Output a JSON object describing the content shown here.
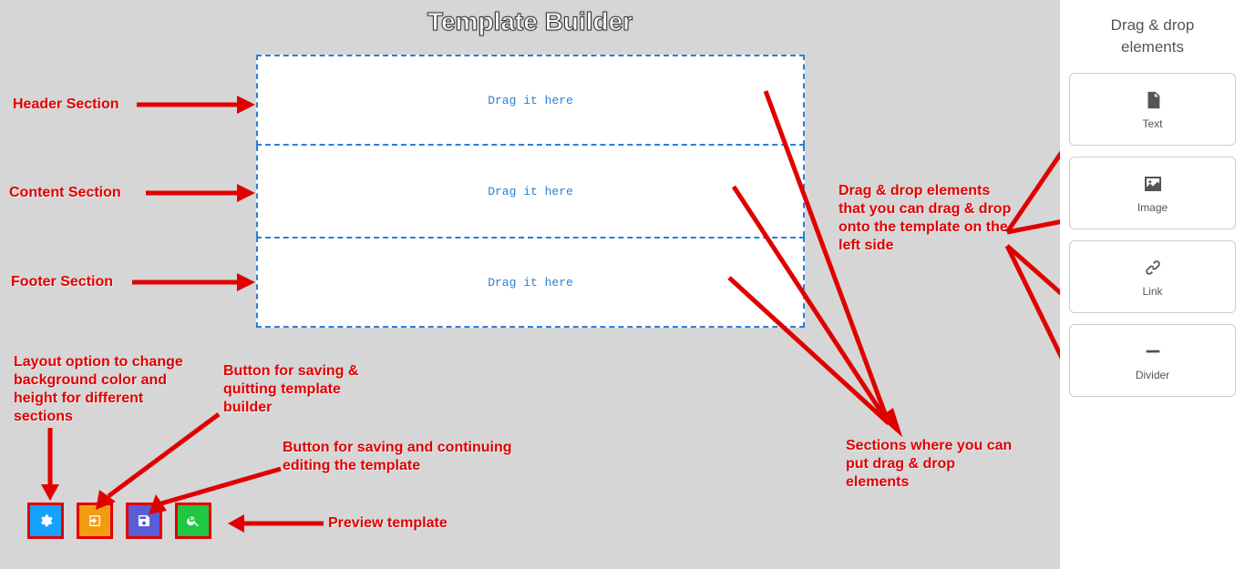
{
  "title": "Template Builder",
  "sidebar": {
    "title": "Drag & drop elements"
  },
  "elements": [
    {
      "label": "Text"
    },
    {
      "label": "Image"
    },
    {
      "label": "Link"
    },
    {
      "label": "Divider"
    }
  ],
  "drop_text": "Drag it here",
  "annotations": {
    "header": "Header Section",
    "content": "Content Section",
    "footer": "Footer Section",
    "layout": "Layout option to change background color and height for different sections",
    "savequit": "Button for saving & quitting template builder",
    "savecont": "Button for saving and continuing editing the template",
    "preview": "Preview template",
    "dd_desc": "Drag & drop elements that you can drag & drop onto the template on the left side",
    "sections_desc": "Sections where you can put drag & drop elements"
  }
}
